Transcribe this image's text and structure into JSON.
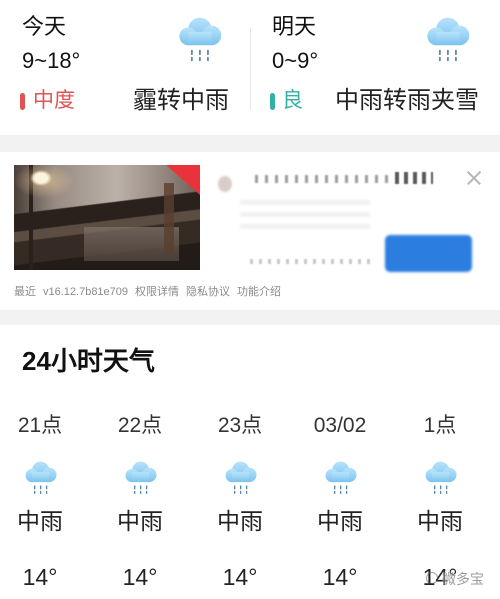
{
  "today": {
    "label": "今天",
    "temp_range": "9~18°",
    "icon": "rain-cloud-icon",
    "aqi_label": "中度",
    "aqi_color": "#e25353",
    "condition": "霾转中雨"
  },
  "tomorrow": {
    "label": "明天",
    "temp_range": "0~9°",
    "icon": "rain-cloud-icon",
    "aqi_label": "良",
    "aqi_color": "#33b0a6",
    "condition": "中雨转雨夹雪"
  },
  "ad": {
    "close_icon": "close-icon",
    "badge_color": "#e8333a",
    "button_color": "#2b7de0",
    "footer": {
      "recent": "最近",
      "version": "v16.12.7b81e709",
      "permissions_link": "权限详情",
      "privacy_link": "隐私协议",
      "features_link": "功能介绍"
    }
  },
  "hourly": {
    "title": "24小时天气",
    "items": [
      {
        "time": "21点",
        "icon": "rain-cloud-icon",
        "condition": "中雨",
        "temp": "14°"
      },
      {
        "time": "22点",
        "icon": "rain-cloud-icon",
        "condition": "中雨",
        "temp": "14°"
      },
      {
        "time": "23点",
        "icon": "rain-cloud-icon",
        "condition": "中雨",
        "temp": "14°"
      },
      {
        "time": "03/02",
        "icon": "rain-cloud-icon",
        "condition": "中雨",
        "temp": "14°"
      },
      {
        "time": "1点",
        "icon": "rain-cloud-icon",
        "condition": "中雨",
        "temp": "14°"
      }
    ]
  },
  "watermark": {
    "text": "微多宝"
  },
  "colors": {
    "separator": "#f2f2f2",
    "text": "#222222",
    "muted": "#8a8a8a",
    "cloud": "#8fcdf2",
    "rain": "#5b87a8"
  }
}
